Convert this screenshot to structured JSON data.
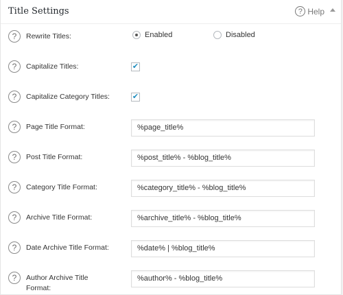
{
  "panel": {
    "title": "Title Settings",
    "help_label": "Help",
    "help_icon": "question-circle-icon"
  },
  "rows": {
    "rewrite_titles": {
      "label": "Rewrite Titles:",
      "options": [
        {
          "label": "Enabled",
          "selected": true
        },
        {
          "label": "Disabled",
          "selected": false
        }
      ]
    },
    "capitalize_titles": {
      "label": "Capitalize Titles:",
      "checked": true,
      "check_glyph": "✔"
    },
    "capitalize_category_titles": {
      "label": "Capitalize Category Titles:",
      "checked": true,
      "check_glyph": "✔"
    },
    "page_title_format": {
      "label": "Page Title Format:",
      "value": "%page_title%"
    },
    "post_title_format": {
      "label": "Post Title Format:",
      "value": "%post_title% - %blog_title%"
    },
    "category_title_format": {
      "label": "Category Title Format:",
      "value": "%category_title% - %blog_title%"
    },
    "archive_title_format": {
      "label": "Archive Title Format:",
      "value": "%archive_title% - %blog_title%"
    },
    "date_archive_title_format": {
      "label": "Date Archive Title Format:",
      "value": "%date% | %blog_title%"
    },
    "author_archive_title_format": {
      "label": "Author Archive Title Format:",
      "value": "%author% - %blog_title%"
    }
  },
  "help_glyph": "?",
  "colors": {
    "panel_bg": "#ffffff",
    "page_bg": "#f1f1f1",
    "icon": "#8a8a8a",
    "check": "#1e8cbe"
  }
}
